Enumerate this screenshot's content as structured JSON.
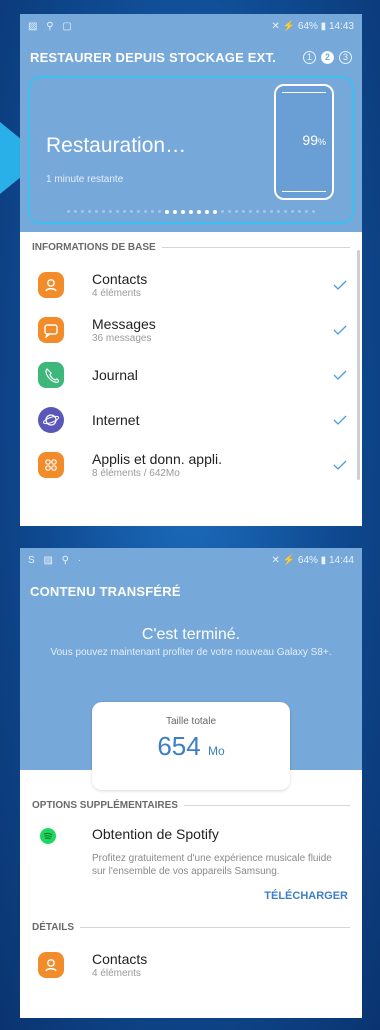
{
  "screen1": {
    "status": {
      "left": "▨ ⚲ ▢",
      "right": "✕ ⚡ 64% ▮ 14:43"
    },
    "title": "RESTAURER DEPUIS STOCKAGE EXT.",
    "steps": [
      "1",
      "2",
      "3"
    ],
    "active_step": 2,
    "restore": {
      "title": "Restauration…",
      "subtitle": "1 minute restante",
      "percent_value": "99",
      "percent_unit": "%"
    },
    "section_label": "INFORMATIONS DE BASE",
    "items": [
      {
        "title": "Contacts",
        "sub": "4 éléments",
        "icon": "contacts-icon",
        "color": "#f28c2a"
      },
      {
        "title": "Messages",
        "sub": "36 messages",
        "icon": "messages-icon",
        "color": "#f28c2a"
      },
      {
        "title": "Journal",
        "sub": "",
        "icon": "phone-log-icon",
        "color": "#3db87a"
      },
      {
        "title": "Internet",
        "sub": "",
        "icon": "internet-icon",
        "color": "#5a57b8"
      },
      {
        "title": "Applis et donn. appli.",
        "sub": "8 éléments / 642Mo",
        "icon": "apps-icon",
        "color": "#f28c2a"
      }
    ]
  },
  "screen2": {
    "status": {
      "left": "S ▨ ⚲ ·",
      "right": "✕ ⚡ 64% ▮ 14:44"
    },
    "title": "CONTENU TRANSFÉRÉ",
    "done_title": "C'est terminé.",
    "done_sub": "Vous pouvez maintenant profiter de votre nouveau Galaxy S8+.",
    "total_label": "Taille totale",
    "total_value": "654",
    "total_unit": "Mo",
    "options_label": "OPTIONS SUPPLÉMENTAIRES",
    "spotify_title": "Obtention de Spotify",
    "spotify_desc": "Profitez gratuitement d'une expérience musicale fluide sur l'ensemble de vos appareils Samsung.",
    "download_label": "TÉLÉCHARGER",
    "details_label": "DÉTAILS",
    "detail_item": {
      "title": "Contacts",
      "sub": "4 éléments"
    }
  },
  "colors": {
    "header": "#76a8d9",
    "accent": "#3d7ec9",
    "check": "#4a9de0",
    "spotify": "#1ed760"
  }
}
